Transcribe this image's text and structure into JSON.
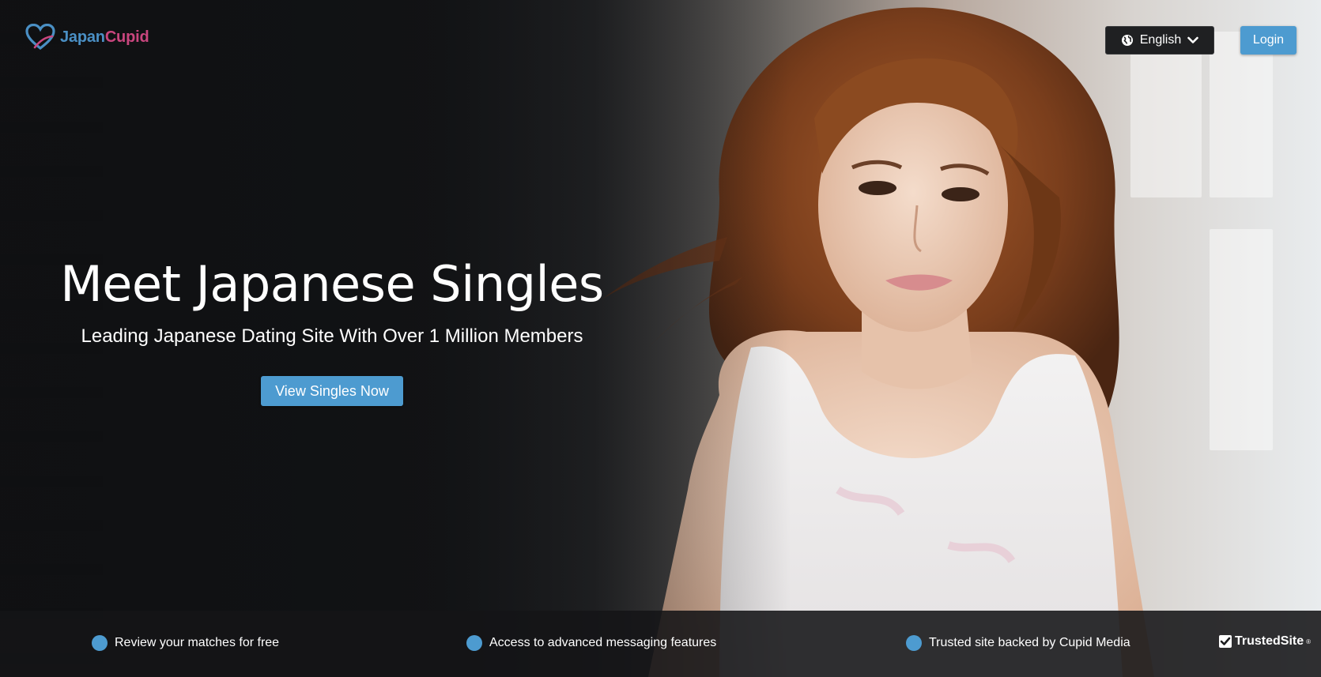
{
  "header": {
    "logo": {
      "part1": "Japan",
      "part2": "Cupid",
      "icon": "heart-logo-icon"
    },
    "language": {
      "label": "English",
      "icon": "globe-icon",
      "chevron": "chevron-down-icon"
    },
    "login_label": "Login"
  },
  "hero": {
    "title": "Meet Japanese Singles",
    "subtitle": "Leading Japanese Dating Site With Over 1 Million Members",
    "cta_label": "View Singles Now"
  },
  "features": [
    {
      "label": "Review your matches for free"
    },
    {
      "label": "Access to advanced messaging features"
    },
    {
      "label": "Trusted site backed by Cupid Media"
    }
  ],
  "badge": {
    "label": "TrustedSite",
    "mark": "®",
    "icon": "checkbox-icon"
  },
  "colors": {
    "accent": "#4d9bd0",
    "logo_blue": "#4a8fc4",
    "logo_pink": "#c9467e",
    "dark_bar": "#141517"
  }
}
